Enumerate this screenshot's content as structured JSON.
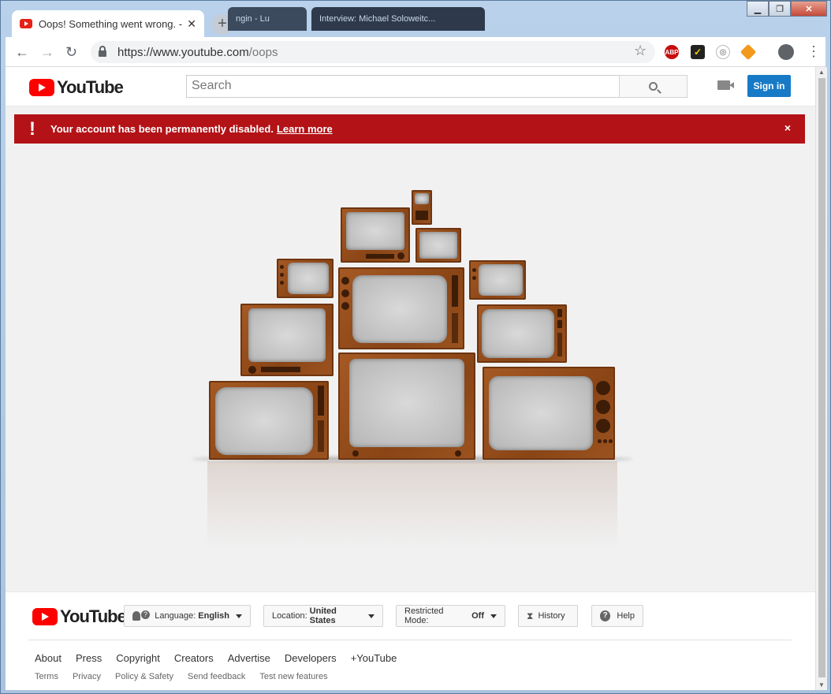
{
  "browser": {
    "active_tab_title": "Oops! Something went wrong. -",
    "bg_tab_1_title": "ngin - Lu",
    "bg_tab_2_title": "Interview: Michael Soloweitc...",
    "url_host": "https://www.youtube.com",
    "url_path": "/oops",
    "ext_abp_label": "ABP"
  },
  "header": {
    "logo_text": "YouTube",
    "search_placeholder": "Search",
    "signin_label": "Sign in"
  },
  "alert": {
    "icon": "!",
    "message": "Your account has been permanently disabled.",
    "link_text": "Learn more",
    "close": "×"
  },
  "footer": {
    "logo_text": "YouTube",
    "language_label": "Language:",
    "language_value": "English",
    "location_label": "Location:",
    "location_value": "United States",
    "restricted_label": "Restricted Mode:",
    "restricted_value": "Off",
    "history_label": "History",
    "help_label": "Help",
    "primary_links": [
      "About",
      "Press",
      "Copyright",
      "Creators",
      "Advertise",
      "Developers",
      "+YouTube"
    ],
    "secondary_links": [
      "Terms",
      "Privacy",
      "Policy & Safety",
      "Send feedback",
      "Test new features"
    ]
  },
  "colors": {
    "brand_red": "#ff0000",
    "alert_red": "#b31217",
    "signin_blue": "#167ac6"
  }
}
